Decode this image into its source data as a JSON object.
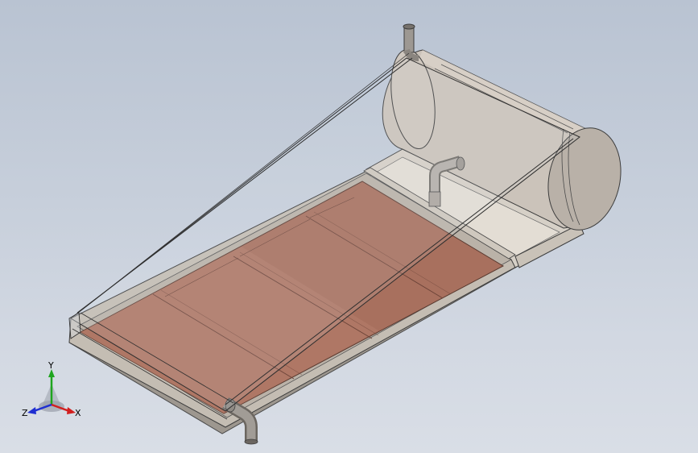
{
  "viewport": {
    "background_top": "#b9c3d2",
    "background_bottom": "#d9dee6"
  },
  "model": {
    "collector_color": "#a8705e",
    "tank_color": "#cbc3ba",
    "frame_color": "#bfb7ad",
    "pipe_color": "#9a9691"
  },
  "triad": {
    "x_label": "X",
    "y_label": "Y",
    "z_label": "Z",
    "x_color": "#d11f1f",
    "y_color": "#1fa51f",
    "z_color": "#1f2fd1"
  }
}
